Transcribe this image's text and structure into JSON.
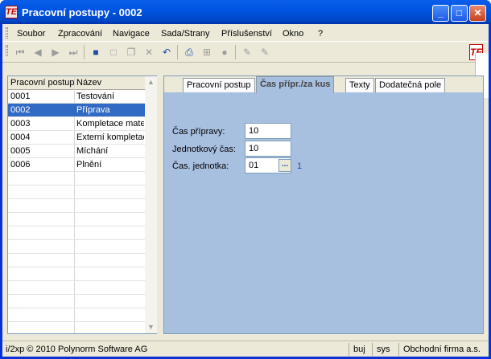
{
  "window": {
    "title": "Pracovní postupy - 0002",
    "icon_text": "TE"
  },
  "menu": [
    "Soubor",
    "Zpracování",
    "Navigace",
    "Sada/Strany",
    "Příslušenství",
    "Okno",
    "?"
  ],
  "list": {
    "columns": [
      "Pracovní postup",
      "Název"
    ],
    "rows": [
      {
        "code": "0001",
        "name": "Testování"
      },
      {
        "code": "0002",
        "name": "Příprava"
      },
      {
        "code": "0003",
        "name": "Kompletace mate"
      },
      {
        "code": "0004",
        "name": "Externí kompletac"
      },
      {
        "code": "0005",
        "name": "Míchání"
      },
      {
        "code": "0006",
        "name": "Plnění"
      }
    ],
    "selected_index": 1
  },
  "tabs": [
    "Pracovní postup",
    "Čas přípr./za kus",
    "Texty",
    "Dodatečná pole"
  ],
  "form": {
    "prep_label": "Čas přípravy:",
    "prep_value": "10",
    "unit_time_label": "Jednotkový čas:",
    "unit_time_value": "10",
    "time_unit_label": "Čas. jednotka:",
    "time_unit_value": "01",
    "lookup_button": "...",
    "time_unit_desc": "1"
  },
  "status": {
    "copyright": "i/2xp © 2010 Polynorm Software AG",
    "user": "buj",
    "db": "sys",
    "company": "Obchodní firma a.s."
  }
}
